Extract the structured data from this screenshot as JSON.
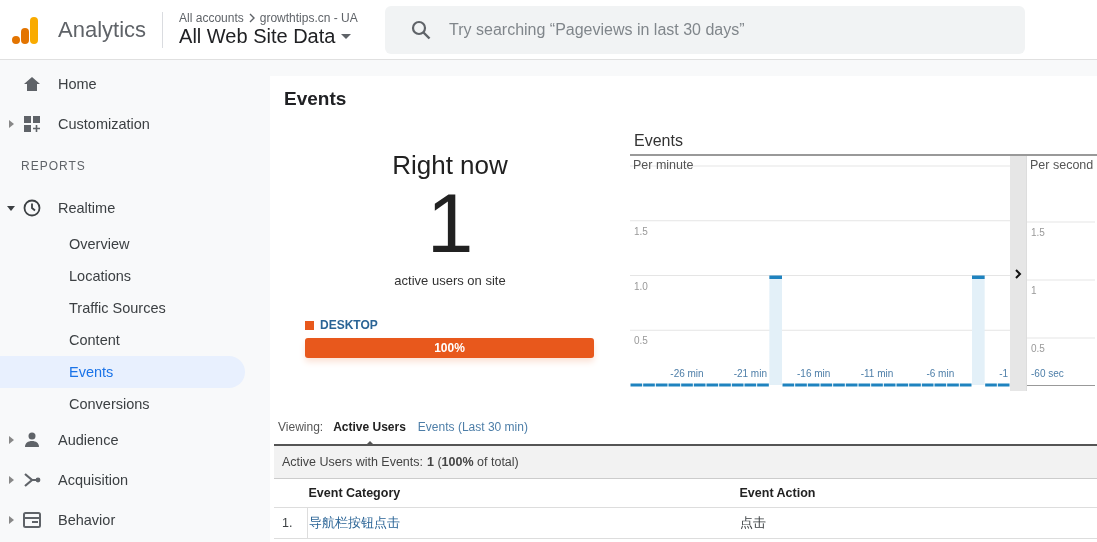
{
  "header": {
    "product": "Analytics",
    "breadcrumb": "All accounts",
    "property": "growthtips.cn - UA",
    "view": "All Web Site Data",
    "search": {
      "placeholder": "Try searching “Pageviews in last 30 days”"
    }
  },
  "sidebar": {
    "items": [
      {
        "label": "Home",
        "selected": false
      },
      {
        "label": "Customization",
        "expanded": false,
        "selected": false
      },
      {
        "kind": "section",
        "label": "REPORTS"
      },
      {
        "label": "Realtime",
        "expanded": true,
        "selected": false,
        "children": [
          {
            "label": "Overview",
            "selected": false
          },
          {
            "label": "Locations",
            "selected": false
          },
          {
            "label": "Traffic Sources",
            "selected": false
          },
          {
            "label": "Content",
            "selected": false
          },
          {
            "label": "Events",
            "selected": true
          },
          {
            "label": "Conversions",
            "selected": false
          }
        ]
      },
      {
        "label": "Audience",
        "expanded": false,
        "selected": false
      },
      {
        "label": "Acquisition",
        "expanded": false,
        "selected": false
      },
      {
        "label": "Behavior",
        "expanded": false,
        "selected": false
      }
    ]
  },
  "page": {
    "title": "Events",
    "right_now": {
      "title": "Right now",
      "count": "1",
      "caption": "active users on site",
      "devices": [
        {
          "label": "DESKTOP",
          "color": "#e8581c",
          "level": 1,
          "reading": "100%"
        }
      ]
    },
    "charts": {
      "title": "Events",
      "per_minute": {
        "chart_data": {
          "type": "bar",
          "title": "Per minute",
          "x": [
            -30,
            -29,
            -28,
            -27,
            -26,
            -25,
            -24,
            -23,
            -22,
            -21,
            -20,
            -19,
            -18,
            -17,
            -16,
            -15,
            -14,
            -13,
            -12,
            -11,
            -10,
            -9,
            -8,
            -7,
            -6,
            -5,
            -4,
            -3,
            -2,
            -1
          ],
          "values": [
            0,
            0,
            0,
            0,
            0,
            0,
            0,
            0,
            0,
            0,
            0,
            1,
            0,
            0,
            0,
            0,
            0,
            0,
            0,
            0,
            0,
            0,
            0,
            0,
            0,
            0,
            0,
            1,
            0,
            0
          ],
          "xlim": [
            -30.5,
            -0.5
          ],
          "ylim": [
            0,
            2
          ],
          "grid": true,
          "yticks": [
            {
              "value": 0.5,
              "label": "0.5"
            },
            {
              "value": 1,
              "label": "1.0"
            },
            {
              "value": 1.5,
              "label": "1.5"
            }
          ],
          "xticks": [
            {
              "value": -26,
              "label": "-26 min"
            },
            {
              "value": -21,
              "label": "-21 min"
            },
            {
              "value": -16,
              "label": "-16 min"
            },
            {
              "value": -11,
              "label": "-11 min"
            },
            {
              "value": -6,
              "label": "-6 min"
            },
            {
              "value": -1,
              "label": "-1"
            }
          ]
        }
      },
      "per_second": {
        "title": "Per second",
        "y_labels": [
          "1.5",
          "1",
          "0.5"
        ],
        "x_label": "-60 sec"
      }
    },
    "viewing": {
      "label": "Viewing:",
      "tabs": [
        {
          "label": "Active Users",
          "selected": true
        },
        {
          "label": "Events (Last 30 min)",
          "selected": false
        }
      ]
    },
    "table": {
      "summary_label": "Active Users with Events:",
      "summary": "**1** (**100%** of total)",
      "columns": [
        "Event Category",
        "Event Action"
      ],
      "rows": [
        {
          "index": "1.",
          "cells": [
            "导航栏按钮点击",
            "点击"
          ]
        }
      ]
    }
  }
}
